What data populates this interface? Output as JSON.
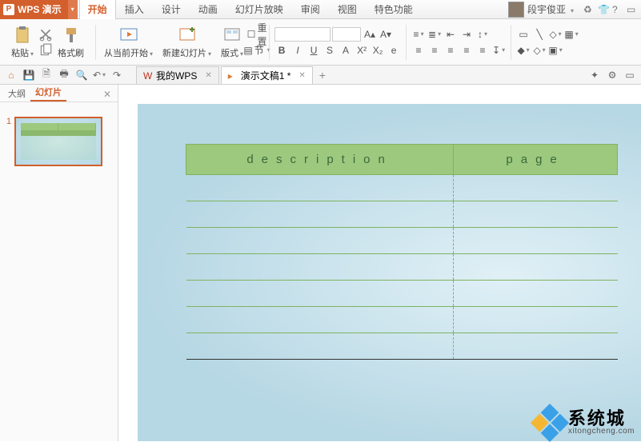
{
  "app": {
    "name": "WPS 演示"
  },
  "user": {
    "name": "段宇俊亚"
  },
  "menu": {
    "tabs": [
      "开始",
      "插入",
      "设计",
      "动画",
      "幻灯片放映",
      "审阅",
      "视图",
      "特色功能"
    ],
    "active": 0
  },
  "ribbon": {
    "paste": "粘贴",
    "format_painter": "格式刷",
    "from_current": "从当前开始",
    "new_slide": "新建幻灯片",
    "layout": "版式",
    "section": "节",
    "reset_label": "重置"
  },
  "qat": {
    "my_wps": "我的WPS",
    "doc1": "演示文稿1 *"
  },
  "side": {
    "outline": "大纲",
    "slides": "幻灯片",
    "slide_num": "1"
  },
  "slide": {
    "col1": "description",
    "col2": "page",
    "rows": 7
  },
  "watermark": {
    "cn": "系统城",
    "en": "xitongcheng.com"
  }
}
